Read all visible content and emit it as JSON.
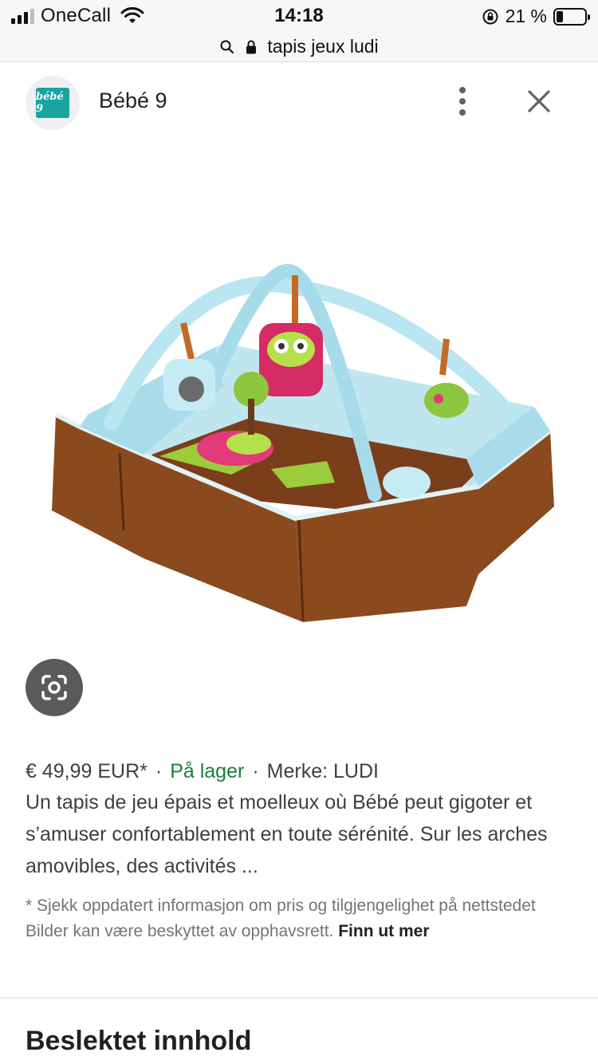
{
  "status_bar": {
    "carrier": "OneCall",
    "time": "14:18",
    "battery": "21 %",
    "battery_level": 0.21
  },
  "url_bar": {
    "text": "tapis jeux ludi"
  },
  "header": {
    "site_name": "Bébé 9",
    "logo_text": "bébé 9"
  },
  "product": {
    "image_alt": "Tapis d'éveil Ludi avec arches et hiboux",
    "price": "€ 49,99 EUR*",
    "availability": "På lager",
    "brand": "Merke: LUDI",
    "separator": "·",
    "description": "Un tapis de jeu épais et moelleux où Bébé peut gigoter et s’amuser confortablement en toute sérénité. Sur les arches amovibles, des activités ...",
    "disclaimer": "* Sjekk oppdatert informasjon om pris og tilgjengelighet på nettstedet Bilder kan være beskyttet av opphavsrett.",
    "learn_more": "Finn ut mer"
  },
  "related": {
    "title": "Beslektet innhold"
  },
  "colors": {
    "stock_green": "#188038",
    "logo_teal": "#18a4a0",
    "mat_brown": "#8b4a1e",
    "mat_blue": "#bfe6ef"
  }
}
